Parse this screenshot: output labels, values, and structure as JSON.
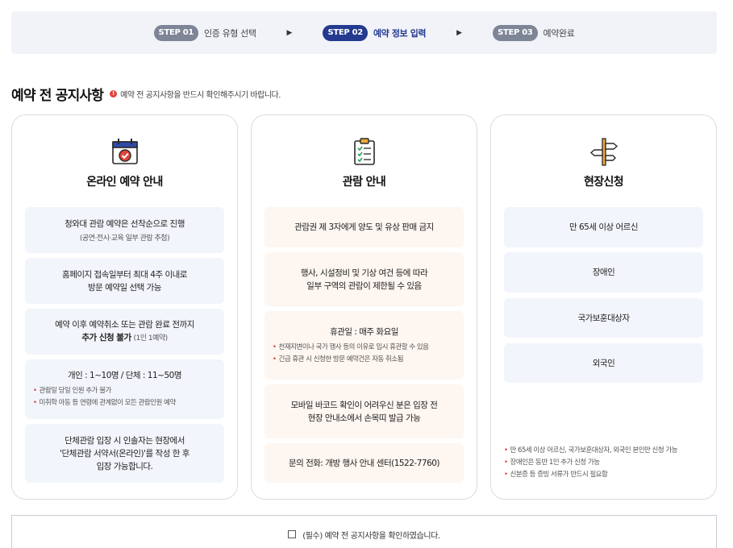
{
  "steps": [
    {
      "badge": "STEP 01",
      "label": "인증 유형 선택",
      "active": false
    },
    {
      "badge": "STEP 02",
      "label": "예약 정보 입력",
      "active": true
    },
    {
      "badge": "STEP 03",
      "label": "예약완료",
      "active": false
    }
  ],
  "arrow_glyph": "▶",
  "section": {
    "title": "예약 전 공지사항",
    "alert_glyph": "!",
    "hint": "예약 전 공지사항을 반드시 확인해주시기 바랍니다."
  },
  "bullet_glyph": "•",
  "online": {
    "title": "온라인 예약 안내",
    "box1_main": "청와대 관람 예약은 선착순으로 진행",
    "box1_sub": "(공연·전시·교육 일부 관람 추첨)",
    "box2_line1": "홈페이지 접속일부터 최대 4주 이내로",
    "box2_line2": "방문 예약일 선택 가능",
    "box3_line1": "예약 이후 예약취소 또는 관람 완료 전까지",
    "box3_line2_bold": "추가 신청 불가",
    "box3_line2_small": "(1인 1예약)",
    "box4_main": "개인 : 1~10명 / 단체 : 11~50명",
    "box4_bullets": [
      "관람일 당일 인원 추가 불가",
      "미취학 아동 등 연령에 관계없이 모든 관람인원 예약"
    ],
    "box5_line1": "단체관람 입장 시 인솔자는 현장에서",
    "box5_line2": "'단체관람 서약서(온라인)'를 작성 한 후",
    "box5_line3": "입장 가능합니다."
  },
  "viewing": {
    "title": "관람 안내",
    "box1_main": "관람권 제 3자에게 양도 및 유상 판매 금지",
    "box2_line1": "행사, 시설정비 및 기상 여건 등에 따라",
    "box2_line2": "일부 구역의 관람이 제한될 수 있음",
    "box3_main": "휴관일 : 매주 화요일",
    "box3_bullets": [
      "천재지변이나 국가 행사 등의 이유로 임시 휴관할 수 있음",
      "긴급 휴관 시 신청한 방문 예약건은 자동 취소됨"
    ],
    "box4_line1": "모바일 바코드 확인이 어려우신 분은 입장 전",
    "box4_line2": "현장 안내소에서 손목띠 발급 가능",
    "box5_main": "문의 전화: 개방 행사 안내 센터(1522-7760)"
  },
  "onsite": {
    "title": "현장신청",
    "items": [
      "만 65세 이상 어르신",
      "장애인",
      "국가보훈대상자",
      "외국인"
    ],
    "notes": [
      "만 65세 이상 어르신, 국가보훈대상자, 외국인 본인만 신청 가능",
      "장애인은 동반 1인 추가 신청 가능",
      "신분증 등 증빙 서류가 반드시 필요함"
    ]
  },
  "agree": {
    "label": "(필수) 예약 전 공지사항을 확인하였습니다."
  },
  "colors": {
    "primary": "#233a8f",
    "inactive_step": "#7d8596",
    "alert": "#e0433a",
    "box_blue": "#f2f5fb",
    "box_peach": "#fdf6f1"
  },
  "icons": {
    "online": "calendar-check-icon",
    "viewing": "clipboard-checklist-icon",
    "onsite": "signpost-icon"
  }
}
